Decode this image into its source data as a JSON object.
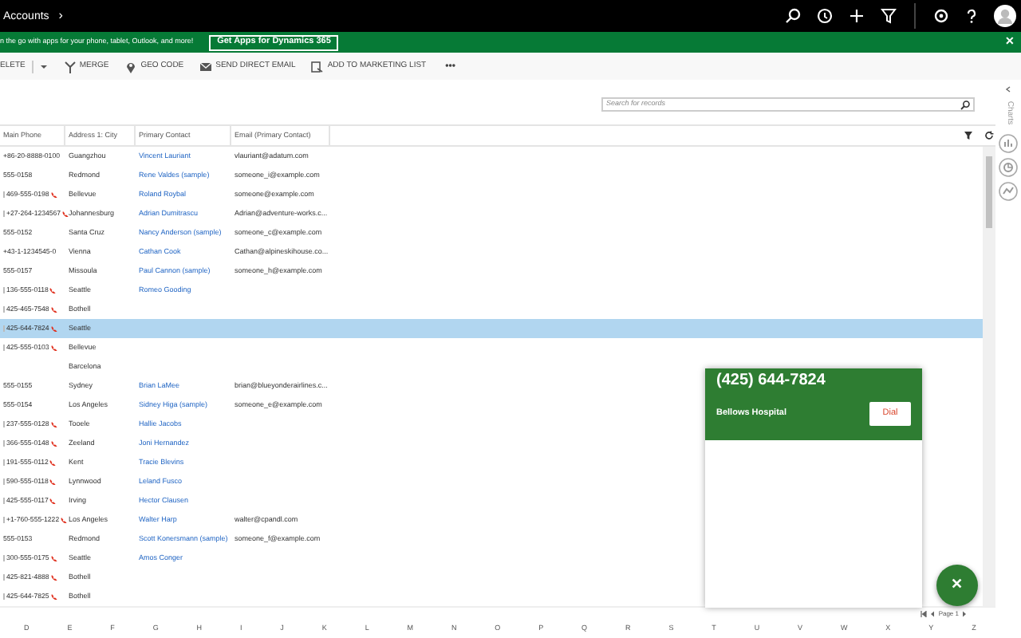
{
  "top_bar": {
    "breadcrumb": "Accounts",
    "breadcrumb_chevron": "›"
  },
  "banner": {
    "text": "n the go with apps for your phone, tablet, Outlook, and more!",
    "button": "Get Apps for Dynamics 365",
    "close": "✕"
  },
  "command_bar": [
    {
      "kind": "dropdown",
      "label": "ELETE"
    },
    {
      "kind": "merge",
      "label": "MERGE"
    },
    {
      "kind": "pin",
      "label": "GEO CODE"
    },
    {
      "kind": "mail",
      "label": "SEND DIRECT EMAIL"
    },
    {
      "kind": "list",
      "label": "ADD TO MARKETING LIST"
    },
    {
      "kind": "more",
      "label": "•••"
    }
  ],
  "search": {
    "placeholder": "Search for records"
  },
  "table": {
    "columns": [
      "Main Phone",
      "Address 1: City",
      "Primary Contact",
      "Email (Primary Contact)"
    ],
    "rows": [
      {
        "phone": "+86-20-8888-0100",
        "call_icon": false,
        "city": "Guangzhou",
        "contact": "Vincent Lauriant",
        "email": "vlauriant@adatum.com",
        "selected": false
      },
      {
        "phone": "555-0158",
        "call_icon": false,
        "city": "Redmond",
        "contact": "Rene Valdes (sample)",
        "email": "someone_i@example.com",
        "selected": false
      },
      {
        "phone": "469-555-0198",
        "call_icon": true,
        "city": "Bellevue",
        "contact": "Roland Roybal",
        "email": "someone@example.com",
        "selected": false
      },
      {
        "phone": "+27-264-1234567",
        "call_icon": true,
        "city": "Johannesburg",
        "contact": "Adrian Dumitrascu",
        "email": "Adrian@adventure-works.c...",
        "selected": false
      },
      {
        "phone": "555-0152",
        "call_icon": false,
        "city": "Santa Cruz",
        "contact": "Nancy Anderson (sample)",
        "email": "someone_c@example.com",
        "selected": false
      },
      {
        "phone": "+43-1-1234545-0",
        "call_icon": false,
        "city": "Vienna",
        "contact": "Cathan Cook",
        "email": "Cathan@alpineskihouse.co...",
        "selected": false
      },
      {
        "phone": "555-0157",
        "call_icon": false,
        "city": "Missoula",
        "contact": "Paul Cannon (sample)",
        "email": "someone_h@example.com",
        "selected": false
      },
      {
        "phone": "136-555-0118",
        "call_icon": true,
        "city": "Seattle",
        "contact": "Romeo Gooding",
        "email": "",
        "selected": false
      },
      {
        "phone": "425-465-7548",
        "call_icon": true,
        "city": "Bothell",
        "contact": "",
        "email": "",
        "selected": false
      },
      {
        "phone": "425-644-7824",
        "call_icon": true,
        "city": "Seattle",
        "contact": "",
        "email": "",
        "selected": true
      },
      {
        "phone": "425-555-0103",
        "call_icon": true,
        "city": "Bellevue",
        "contact": "",
        "email": "",
        "selected": false
      },
      {
        "phone": "",
        "call_icon": false,
        "city": "Barcelona",
        "contact": "",
        "email": "",
        "selected": false
      },
      {
        "phone": "555-0155",
        "call_icon": false,
        "city": "Sydney",
        "contact": "Brian LaMee",
        "email": "brian@blueyonderairlines.c...",
        "selected": false
      },
      {
        "phone": "555-0154",
        "call_icon": false,
        "city": "Los Angeles",
        "contact": "Sidney Higa (sample)",
        "email": "someone_e@example.com",
        "selected": false
      },
      {
        "phone": "237-555-0128",
        "call_icon": true,
        "city": "Tooele",
        "contact": "Hallie Jacobs",
        "email": "",
        "selected": false
      },
      {
        "phone": "366-555-0148",
        "call_icon": true,
        "city": "Zeeland",
        "contact": "Joni Hernandez",
        "email": "",
        "selected": false
      },
      {
        "phone": "191-555-0112",
        "call_icon": true,
        "city": "Kent",
        "contact": "Tracie Blevins",
        "email": "",
        "selected": false
      },
      {
        "phone": "590-555-0118",
        "call_icon": true,
        "city": "Lynnwood",
        "contact": "Leland Fusco",
        "email": "",
        "selected": false
      },
      {
        "phone": "425-555-0117",
        "call_icon": true,
        "city": "Irving",
        "contact": "Hector Clausen",
        "email": "",
        "selected": false
      },
      {
        "phone": "+1-760-555-1222",
        "call_icon": true,
        "city": "Los Angeles",
        "contact": "Walter Harp",
        "email": "walter@cpandl.com",
        "selected": false
      },
      {
        "phone": "555-0153",
        "call_icon": false,
        "city": "Redmond",
        "contact": "Scott Konersmann (sample)",
        "email": "someone_f@example.com",
        "selected": false
      },
      {
        "phone": "300-555-0175",
        "call_icon": true,
        "city": "Seattle",
        "contact": "Amos Conger",
        "email": "",
        "selected": false
      },
      {
        "phone": "425-821-4888",
        "call_icon": true,
        "city": "Bothell",
        "contact": "",
        "email": "",
        "selected": false
      },
      {
        "phone": "425-644-7825",
        "call_icon": true,
        "city": "Bothell",
        "contact": "",
        "email": "",
        "selected": false
      }
    ]
  },
  "pagination": {
    "label": "Page 1"
  },
  "letters": [
    "D",
    "E",
    "F",
    "G",
    "H",
    "I",
    "J",
    "K",
    "L",
    "M",
    "N",
    "O",
    "P",
    "Q",
    "R",
    "S",
    "T",
    "U",
    "V",
    "W",
    "X",
    "Y",
    "Z"
  ],
  "charts_panel": {
    "title": "Charts"
  },
  "call_card": {
    "phone": "(425) 644-7824",
    "name": "Bellows Hospital",
    "button": "Dial"
  },
  "fab": {
    "label": "✕"
  }
}
